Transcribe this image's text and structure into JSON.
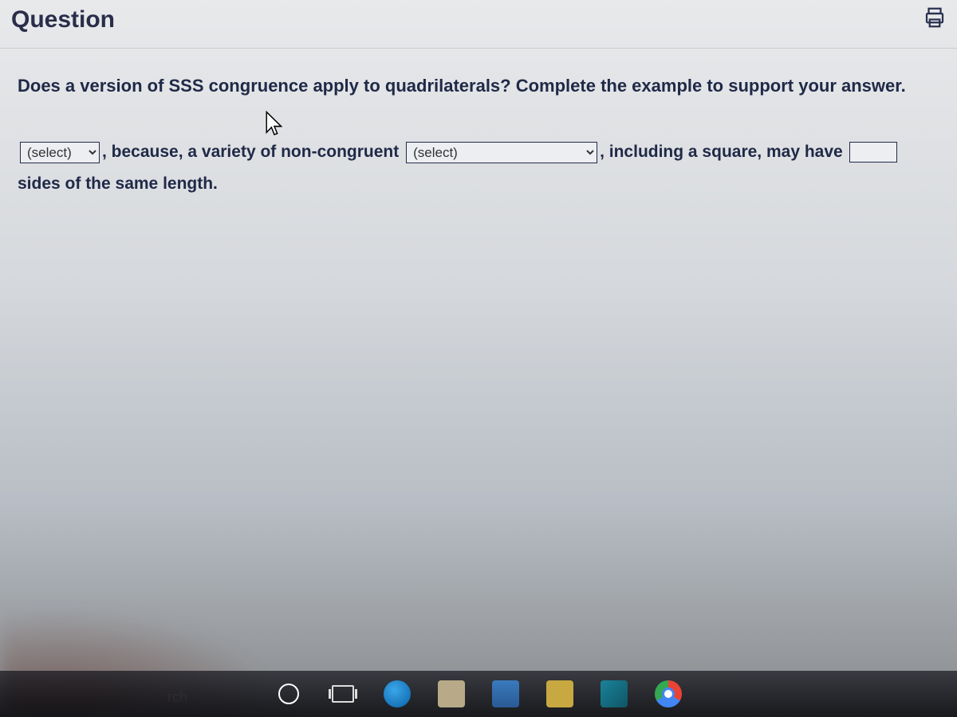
{
  "header": {
    "title": "Question"
  },
  "question": {
    "prompt": "Does a version of SSS congruence apply to quadrilaterals? Complete the example to support your answer."
  },
  "answer": {
    "select1_placeholder": "(select)",
    "text_after_select1": ", because, a variety of non-congruent ",
    "select2_placeholder": "(select)",
    "text_after_select2": ", including a square, may have ",
    "input_value": "",
    "text_tail": " sides of the same length."
  },
  "taskbar": {
    "search_hint": "rch"
  },
  "icons": {
    "print": "print-icon",
    "cursor": "cursor-icon"
  }
}
